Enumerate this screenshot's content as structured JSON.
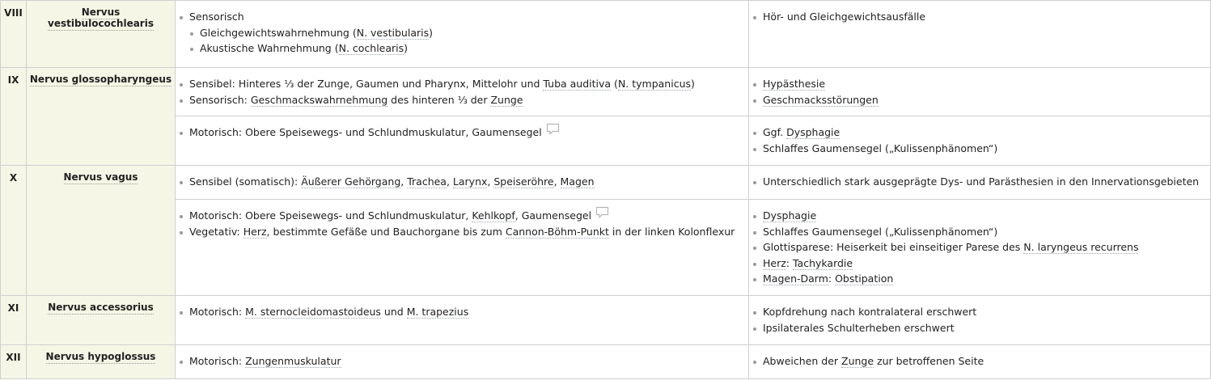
{
  "rows": [
    {
      "num": "VIII",
      "name": "Nervus vestibulocochlearis",
      "func1": {
        "item1_text": "Sensorisch",
        "sub1_prefix": "Gleichgewichtswahrnehmung (",
        "sub1_link": "N. vestibularis",
        "sub1_suffix": ")",
        "sub2_prefix": "Akustische Wahrnehmung (",
        "sub2_link": "N. cochlearis",
        "sub2_suffix": ")"
      },
      "deficit1": {
        "item1_text": "Hör- und Gleichgewichtsausfälle"
      }
    },
    {
      "num": "IX",
      "name": "Nervus glossopharyngeus",
      "func1": {
        "item1_prefix": "Sensibel: Hinteres ⅓ der Zunge, Gaumen und Pharynx, Mittelohr und ",
        "item1_link1": "Tuba auditiva",
        "item1_mid": " (",
        "item1_link2": "N. tympanicus",
        "item1_suffix": ")",
        "item2_prefix": "Sensorisch: ",
        "item2_link": "Geschmackswahrnehmung",
        "item2_mid": " des hinteren ⅓ der ",
        "item2_link2": "Zunge"
      },
      "deficit1": {
        "item1_link": "Hypästhesie",
        "item2_link": "Geschmacksstörungen"
      },
      "func2": {
        "item1_text": "Motorisch: Obere Speisewegs- und Schlundmuskulatur, Gaumensegel",
        "icon": "comment-icon"
      },
      "deficit2": {
        "item1_prefix": "Ggf. ",
        "item1_link": "Dysphagie",
        "item2_text": "Schlaffes Gaumensegel („Kulissenphänomen“)"
      }
    },
    {
      "num": "X",
      "name": "Nervus vagus",
      "func1": {
        "item1_prefix": "Sensibel (somatisch): ",
        "item1_link1": "Äußerer Gehörgang",
        "item1_sep1": ", ",
        "item1_link2": "Trachea",
        "item1_sep2": ", ",
        "item1_link3": "Larynx",
        "item1_sep3": ", ",
        "item1_link4": "Speiseröhre",
        "item1_sep4": ", ",
        "item1_link5": "Magen"
      },
      "deficit1": {
        "item1_text": "Unterschiedlich stark ausgeprägte Dys- und Parästhesien in den Innervationsgebieten"
      },
      "func2": {
        "item1_prefix": "Motorisch: Obere Speisewegs- und Schlundmuskulatur, ",
        "item1_link": "Kehlkopf",
        "item1_suffix": ", Gaumensegel",
        "icon": "comment-icon",
        "item2_prefix": "Vegetativ: ",
        "item2_link1": "Herz",
        "item2_mid": ", bestimmte Gefäße und Bauchorgane bis zum ",
        "item2_link2": "Cannon-Böhm-Punkt",
        "item2_suffix": " in der linken Kolonflexur"
      },
      "deficit2": {
        "item1_link": "Dysphagie",
        "item2_text": "Schlaffes Gaumensegel („Kulissenphänomen“)",
        "item3_prefix": "Glottisparese: Heiserkeit bei einseitiger Parese des ",
        "item3_link": "N. laryngeus recurrens",
        "item4_link": "Herz",
        "item4_mid": ": ",
        "item4_link2": "Tachykardie",
        "item5_link1": "Magen-Darm",
        "item5_mid": ": ",
        "item5_link2": "Obstipation"
      }
    },
    {
      "num": "XI",
      "name": "Nervus accessorius",
      "func1": {
        "item1_prefix": "Motorisch: ",
        "item1_link1": "M. sternocleidomastoideus",
        "item1_mid": " und ",
        "item1_link2": "M. trapezius"
      },
      "deficit1": {
        "item1_text": "Kopfdrehung nach kontralateral erschwert",
        "item2_text": "Ipsilaterales Schulterheben erschwert"
      }
    },
    {
      "num": "XII",
      "name": "Nervus hypoglossus",
      "func1": {
        "item1_prefix": "Motorisch: ",
        "item1_link": "Zungenmuskulatur"
      },
      "deficit1": {
        "item1_prefix": "Abweichen der ",
        "item1_link": "Zunge",
        "item1_suffix": " zur betroffenen Seite"
      }
    }
  ]
}
